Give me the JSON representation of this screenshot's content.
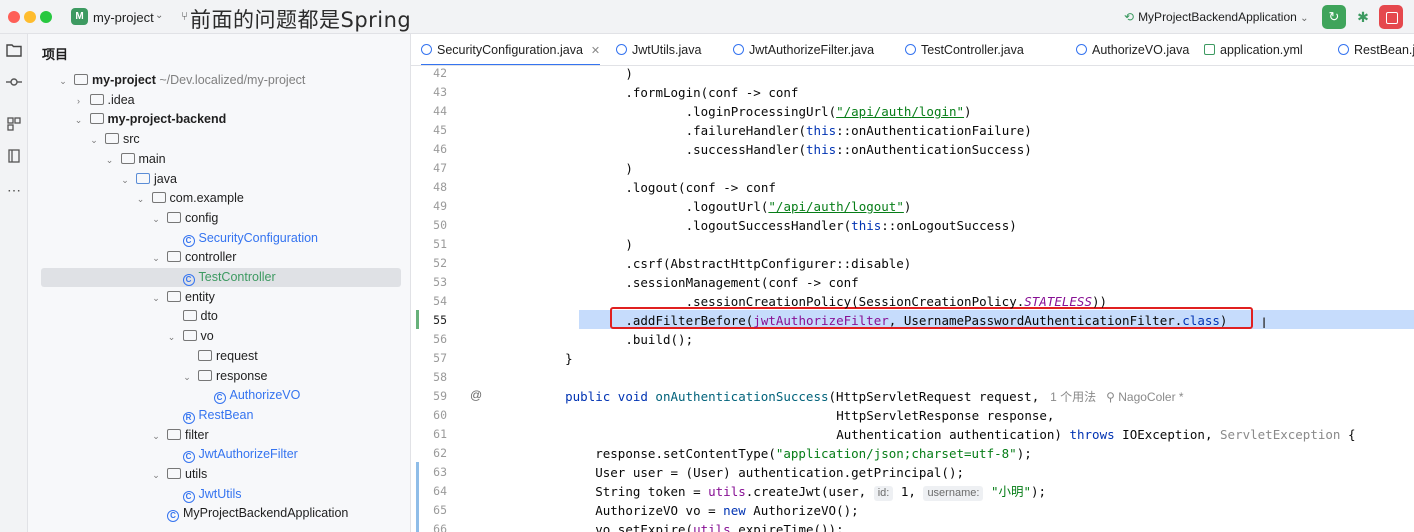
{
  "titlebar": {
    "project_badge": "M",
    "project_name": "my-project",
    "overlay_caption": "前面的问题都是Spring",
    "run_config": "MyProjectBackendApplication",
    "icons": [
      "branch-icon",
      "run-icon",
      "debug-icon",
      "stop-icon"
    ]
  },
  "activity_bar": {
    "icons": [
      "folder-icon",
      "commit-icon",
      "structure-icon",
      "bookmarks-icon",
      "more-icon"
    ]
  },
  "project_panel": {
    "title": "项目",
    "tree": [
      {
        "name": "my-project",
        "suffix": "~/Dev.localized/my-project",
        "depth": 0,
        "kind": "module",
        "open": true
      },
      {
        "name": ".idea",
        "depth": 1,
        "kind": "folder",
        "open": false
      },
      {
        "name": "my-project-backend",
        "depth": 1,
        "kind": "module",
        "open": true
      },
      {
        "name": "src",
        "depth": 2,
        "kind": "folder",
        "open": true
      },
      {
        "name": "main",
        "depth": 3,
        "kind": "folder",
        "open": true
      },
      {
        "name": "java",
        "depth": 4,
        "kind": "src-folder",
        "open": true
      },
      {
        "name": "com.example",
        "depth": 5,
        "kind": "package",
        "open": true
      },
      {
        "name": "config",
        "depth": 6,
        "kind": "package",
        "open": true
      },
      {
        "name": "SecurityConfiguration",
        "depth": 7,
        "kind": "class"
      },
      {
        "name": "controller",
        "depth": 6,
        "kind": "package",
        "open": true
      },
      {
        "name": "TestController",
        "depth": 7,
        "kind": "class",
        "selected": true
      },
      {
        "name": "entity",
        "depth": 6,
        "kind": "package",
        "open": true
      },
      {
        "name": "dto",
        "depth": 7,
        "kind": "package"
      },
      {
        "name": "vo",
        "depth": 7,
        "kind": "package",
        "open": true
      },
      {
        "name": "request",
        "depth": 8,
        "kind": "package"
      },
      {
        "name": "response",
        "depth": 8,
        "kind": "package",
        "open": true
      },
      {
        "name": "AuthorizeVO",
        "depth": 9,
        "kind": "class"
      },
      {
        "name": "RestBean",
        "depth": 7,
        "kind": "record"
      },
      {
        "name": "filter",
        "depth": 6,
        "kind": "package",
        "open": true
      },
      {
        "name": "JwtAuthorizeFilter",
        "depth": 7,
        "kind": "class"
      },
      {
        "name": "utils",
        "depth": 6,
        "kind": "package",
        "open": true
      },
      {
        "name": "JwtUtils",
        "depth": 7,
        "kind": "class"
      },
      {
        "name": "MyProjectBackendApplication",
        "depth": 6,
        "kind": "spring-class"
      }
    ]
  },
  "tabs": [
    {
      "label": "SecurityConfiguration.java",
      "active": true,
      "icon": "class-icon"
    },
    {
      "label": "JwtUtils.java",
      "icon": "class-icon"
    },
    {
      "label": "JwtAuthorizeFilter.java",
      "icon": "class-icon"
    },
    {
      "label": "TestController.java",
      "icon": "class-icon"
    },
    {
      "label": "AuthorizeVO.java",
      "icon": "class-icon"
    },
    {
      "label": "application.yml",
      "icon": "yml-icon"
    },
    {
      "label": "RestBean.ja",
      "icon": "class-icon"
    }
  ],
  "editor": {
    "highlighted_line": 55,
    "lines": [
      {
        "n": "42",
        "indent": 12,
        "segs": [
          [
            "p",
            ")"
          ]
        ]
      },
      {
        "n": "43",
        "indent": 12,
        "segs": [
          [
            "p",
            ".formLogin(conf -> conf"
          ]
        ]
      },
      {
        "n": "44",
        "indent": 20,
        "segs": [
          [
            "p",
            ".loginProcessingUrl("
          ],
          [
            "url",
            "\"/api/auth/login\""
          ],
          [
            "p",
            ")"
          ]
        ]
      },
      {
        "n": "45",
        "indent": 20,
        "segs": [
          [
            "p",
            ".failureHandler("
          ],
          [
            "kw",
            "this"
          ],
          [
            "p",
            "::onAuthenticationFailure)"
          ]
        ]
      },
      {
        "n": "46",
        "indent": 20,
        "segs": [
          [
            "p",
            ".successHandler("
          ],
          [
            "kw",
            "this"
          ],
          [
            "p",
            "::onAuthenticationSuccess)"
          ]
        ]
      },
      {
        "n": "47",
        "indent": 12,
        "segs": [
          [
            "p",
            ")"
          ]
        ]
      },
      {
        "n": "48",
        "indent": 12,
        "segs": [
          [
            "p",
            ".logout(conf -> conf"
          ]
        ]
      },
      {
        "n": "49",
        "indent": 20,
        "segs": [
          [
            "p",
            ".logoutUrl("
          ],
          [
            "url",
            "\"/api/auth/logout\""
          ],
          [
            "p",
            ")"
          ]
        ]
      },
      {
        "n": "50",
        "indent": 20,
        "segs": [
          [
            "p",
            ".logoutSuccessHandler("
          ],
          [
            "kw",
            "this"
          ],
          [
            "p",
            "::onLogoutSuccess)"
          ]
        ]
      },
      {
        "n": "51",
        "indent": 12,
        "segs": [
          [
            "p",
            ")"
          ]
        ]
      },
      {
        "n": "52",
        "indent": 12,
        "segs": [
          [
            "p",
            ".csrf(AbstractHttpConfigurer::disable)"
          ]
        ]
      },
      {
        "n": "53",
        "indent": 12,
        "segs": [
          [
            "p",
            ".sessionManagement(conf -> conf"
          ]
        ]
      },
      {
        "n": "54",
        "indent": 20,
        "segs": [
          [
            "p",
            ".sessionCreationPolicy(SessionCreationPolicy."
          ],
          [
            "st",
            "STATELESS"
          ],
          [
            "p",
            "))"
          ]
        ]
      },
      {
        "n": "55",
        "indent": 12,
        "segs": [
          [
            "p",
            ".addFilterBefore("
          ],
          [
            "fld",
            "jwtAuthorizeFilter"
          ],
          [
            "p",
            ", UsernamePasswordAuthenticationFilter."
          ],
          [
            "kw",
            "class"
          ],
          [
            "p",
            ")"
          ]
        ]
      },
      {
        "n": "56",
        "indent": 12,
        "segs": [
          [
            "p",
            ".build();"
          ]
        ]
      },
      {
        "n": "57",
        "indent": 4,
        "segs": [
          [
            "p",
            "}"
          ]
        ]
      },
      {
        "n": "58",
        "indent": 0,
        "segs": []
      },
      {
        "n": "59",
        "indent": 4,
        "segs": [
          [
            "kw",
            "public void "
          ],
          [
            "fn",
            "onAuthenticationSuccess"
          ],
          [
            "p",
            "(HttpServletRequest request, "
          ],
          [
            "inlay",
            " 1 个用法   ⚲ NagoColer *"
          ]
        ]
      },
      {
        "n": "60",
        "indent": 40,
        "segs": [
          [
            "p",
            "HttpServletResponse response,"
          ]
        ]
      },
      {
        "n": "61",
        "indent": 40,
        "segs": [
          [
            "p",
            "Authentication authentication) "
          ],
          [
            "kw",
            "throws "
          ],
          [
            "p",
            "IOException, "
          ],
          [
            "exc",
            "ServletException"
          ],
          [
            "p",
            " {"
          ]
        ]
      },
      {
        "n": "62",
        "indent": 8,
        "segs": [
          [
            "p",
            "response.setContentType("
          ],
          [
            "str",
            "\"application/json;charset=utf-8\""
          ],
          [
            "p",
            ");"
          ]
        ]
      },
      {
        "n": "63",
        "indent": 8,
        "segs": [
          [
            "p",
            "User user = (User) authentication.getPrincipal();"
          ]
        ]
      },
      {
        "n": "64",
        "indent": 8,
        "segs": [
          [
            "p",
            "String token = "
          ],
          [
            "fld",
            "utils"
          ],
          [
            "p",
            ".createJwt(user, "
          ],
          [
            "hint",
            "id:"
          ],
          [
            "p",
            " 1, "
          ],
          [
            "hint",
            "username:"
          ],
          [
            "p",
            " "
          ],
          [
            "str",
            "\"小明\""
          ],
          [
            "p",
            ");"
          ]
        ]
      },
      {
        "n": "65",
        "indent": 8,
        "segs": [
          [
            "p",
            "AuthorizeVO vo = "
          ],
          [
            "kw",
            "new "
          ],
          [
            "p",
            "AuthorizeVO();"
          ]
        ]
      },
      {
        "n": "66",
        "indent": 8,
        "segs": [
          [
            "p",
            "vo.setExpire("
          ],
          [
            "fld",
            "utils"
          ],
          [
            "p",
            ".expireTime());"
          ]
        ]
      }
    ]
  }
}
